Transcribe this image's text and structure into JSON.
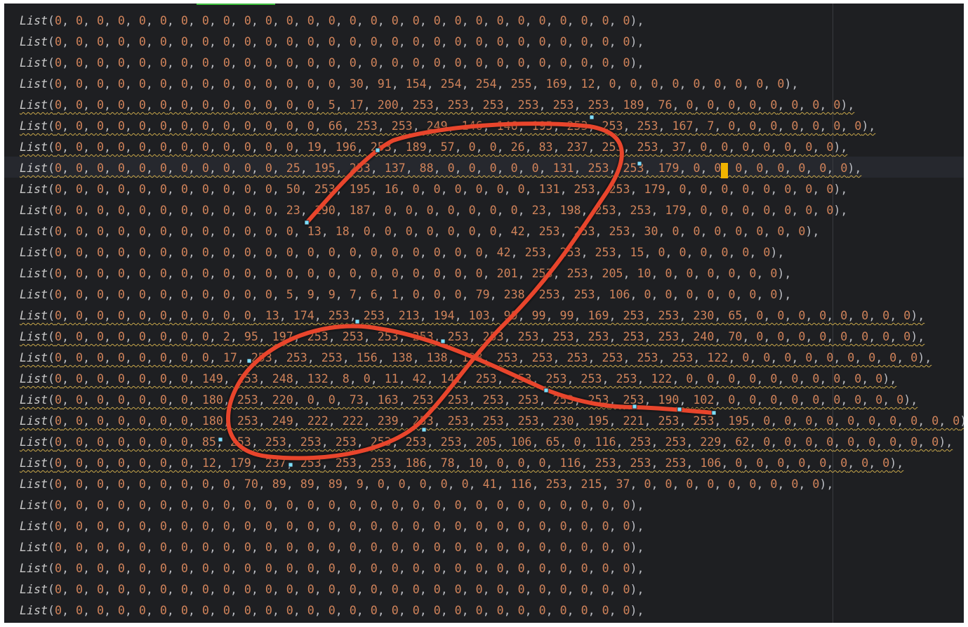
{
  "editor": {
    "keyword": "List",
    "current_line_index": 7,
    "caret_line": 7,
    "caret_col_index": 26,
    "squiggle_lines": [
      4,
      5,
      6,
      7,
      14,
      15,
      16,
      17,
      18,
      19,
      20,
      21
    ],
    "rows": [
      [
        0,
        0,
        0,
        0,
        0,
        0,
        0,
        0,
        0,
        0,
        0,
        0,
        0,
        0,
        0,
        0,
        0,
        0,
        0,
        0,
        0,
        0,
        0,
        0,
        0,
        0,
        0,
        0
      ],
      [
        0,
        0,
        0,
        0,
        0,
        0,
        0,
        0,
        0,
        0,
        0,
        0,
        0,
        0,
        0,
        0,
        0,
        0,
        0,
        0,
        0,
        0,
        0,
        0,
        0,
        0,
        0,
        0
      ],
      [
        0,
        0,
        0,
        0,
        0,
        0,
        0,
        0,
        0,
        0,
        0,
        0,
        0,
        0,
        0,
        0,
        0,
        0,
        0,
        0,
        0,
        0,
        0,
        0,
        0,
        0,
        0,
        0
      ],
      [
        0,
        0,
        0,
        0,
        0,
        0,
        0,
        0,
        0,
        0,
        0,
        0,
        0,
        0,
        30,
        91,
        154,
        254,
        254,
        255,
        169,
        12,
        0,
        0,
        0,
        0,
        0,
        0,
        0,
        0,
        0
      ],
      [
        0,
        0,
        0,
        0,
        0,
        0,
        0,
        0,
        0,
        0,
        0,
        0,
        0,
        5,
        17,
        200,
        253,
        253,
        253,
        253,
        253,
        253,
        189,
        76,
        0,
        0,
        0,
        0,
        0,
        0,
        0,
        0
      ],
      [
        0,
        0,
        0,
        0,
        0,
        0,
        0,
        0,
        0,
        0,
        0,
        0,
        0,
        66,
        253,
        253,
        249,
        146,
        146,
        195,
        253,
        253,
        253,
        167,
        7,
        0,
        0,
        0,
        0,
        0,
        0,
        0
      ],
      [
        0,
        0,
        0,
        0,
        0,
        0,
        0,
        0,
        0,
        0,
        0,
        0,
        19,
        196,
        253,
        189,
        57,
        0,
        0,
        26,
        83,
        237,
        253,
        253,
        37,
        0,
        0,
        0,
        0,
        0,
        0,
        0
      ],
      [
        0,
        0,
        0,
        0,
        0,
        0,
        0,
        0,
        0,
        0,
        0,
        25,
        195,
        253,
        137,
        88,
        0,
        0,
        0,
        0,
        0,
        131,
        253,
        253,
        179,
        0,
        0,
        0,
        0,
        0,
        0,
        0,
        0
      ],
      [
        0,
        0,
        0,
        0,
        0,
        0,
        0,
        0,
        0,
        0,
        0,
        50,
        253,
        195,
        16,
        0,
        0,
        0,
        0,
        0,
        0,
        131,
        253,
        253,
        179,
        0,
        0,
        0,
        0,
        0,
        0,
        0,
        0
      ],
      [
        0,
        0,
        0,
        0,
        0,
        0,
        0,
        0,
        0,
        0,
        0,
        23,
        190,
        187,
        0,
        0,
        0,
        0,
        0,
        0,
        0,
        23,
        198,
        253,
        253,
        179,
        0,
        0,
        0,
        0,
        0,
        0,
        0
      ],
      [
        0,
        0,
        0,
        0,
        0,
        0,
        0,
        0,
        0,
        0,
        0,
        0,
        13,
        18,
        0,
        0,
        0,
        0,
        0,
        0,
        0,
        42,
        253,
        253,
        253,
        30,
        0,
        0,
        0,
        0,
        0,
        0,
        0
      ],
      [
        0,
        0,
        0,
        0,
        0,
        0,
        0,
        0,
        0,
        0,
        0,
        0,
        0,
        0,
        0,
        0,
        0,
        0,
        0,
        0,
        0,
        42,
        253,
        253,
        253,
        15,
        0,
        0,
        0,
        0,
        0,
        0
      ],
      [
        0,
        0,
        0,
        0,
        0,
        0,
        0,
        0,
        0,
        0,
        0,
        0,
        0,
        0,
        0,
        0,
        0,
        0,
        0,
        0,
        0,
        201,
        253,
        253,
        205,
        10,
        0,
        0,
        0,
        0,
        0,
        0
      ],
      [
        0,
        0,
        0,
        0,
        0,
        0,
        0,
        0,
        0,
        0,
        0,
        5,
        9,
        9,
        7,
        6,
        1,
        0,
        0,
        0,
        79,
        238,
        253,
        253,
        106,
        0,
        0,
        0,
        0,
        0,
        0,
        0
      ],
      [
        0,
        0,
        0,
        0,
        0,
        0,
        0,
        0,
        0,
        0,
        13,
        174,
        253,
        253,
        213,
        194,
        103,
        99,
        99,
        99,
        169,
        253,
        253,
        230,
        65,
        0,
        0,
        0,
        0,
        0,
        0,
        0,
        0
      ],
      [
        0,
        0,
        0,
        0,
        0,
        0,
        0,
        0,
        2,
        95,
        197,
        253,
        253,
        253,
        253,
        253,
        253,
        253,
        253,
        253,
        253,
        253,
        240,
        70,
        0,
        0,
        0,
        0,
        0,
        0,
        0,
        0
      ],
      [
        0,
        0,
        0,
        0,
        0,
        0,
        0,
        0,
        17,
        253,
        253,
        253,
        156,
        138,
        138,
        138,
        253,
        253,
        253,
        253,
        253,
        253,
        122,
        0,
        0,
        0,
        0,
        0,
        0,
        0,
        0,
        0
      ],
      [
        0,
        0,
        0,
        0,
        0,
        0,
        0,
        149,
        253,
        248,
        132,
        8,
        0,
        11,
        42,
        141,
        253,
        253,
        253,
        253,
        253,
        122,
        0,
        0,
        0,
        0,
        0,
        0,
        0,
        0,
        0,
        0
      ],
      [
        0,
        0,
        0,
        0,
        0,
        0,
        0,
        180,
        253,
        220,
        0,
        0,
        73,
        163,
        253,
        253,
        253,
        253,
        253,
        253,
        253,
        190,
        102,
        0,
        0,
        0,
        0,
        0,
        0,
        0,
        0,
        0
      ],
      [
        0,
        0,
        0,
        0,
        0,
        0,
        0,
        180,
        253,
        249,
        222,
        222,
        239,
        253,
        253,
        253,
        253,
        230,
        195,
        221,
        253,
        253,
        195,
        0,
        0,
        0,
        0,
        0,
        0,
        0,
        0,
        0,
        0
      ],
      [
        0,
        0,
        0,
        0,
        0,
        0,
        0,
        85,
        253,
        253,
        253,
        253,
        253,
        253,
        253,
        205,
        106,
        65,
        0,
        116,
        253,
        253,
        229,
        62,
        0,
        0,
        0,
        0,
        0,
        0,
        0,
        0,
        0
      ],
      [
        0,
        0,
        0,
        0,
        0,
        0,
        0,
        12,
        179,
        237,
        253,
        253,
        253,
        186,
        78,
        10,
        0,
        0,
        0,
        116,
        253,
        253,
        253,
        106,
        0,
        0,
        0,
        0,
        0,
        0,
        0,
        0
      ],
      [
        0,
        0,
        0,
        0,
        0,
        0,
        0,
        0,
        0,
        70,
        89,
        89,
        89,
        9,
        0,
        0,
        0,
        0,
        0,
        41,
        116,
        253,
        215,
        37,
        0,
        0,
        0,
        0,
        0,
        0,
        0,
        0,
        0
      ],
      [
        0,
        0,
        0,
        0,
        0,
        0,
        0,
        0,
        0,
        0,
        0,
        0,
        0,
        0,
        0,
        0,
        0,
        0,
        0,
        0,
        0,
        0,
        0,
        0,
        0,
        0,
        0,
        0
      ],
      [
        0,
        0,
        0,
        0,
        0,
        0,
        0,
        0,
        0,
        0,
        0,
        0,
        0,
        0,
        0,
        0,
        0,
        0,
        0,
        0,
        0,
        0,
        0,
        0,
        0,
        0,
        0,
        0
      ],
      [
        0,
        0,
        0,
        0,
        0,
        0,
        0,
        0,
        0,
        0,
        0,
        0,
        0,
        0,
        0,
        0,
        0,
        0,
        0,
        0,
        0,
        0,
        0,
        0,
        0,
        0,
        0,
        0
      ],
      [
        0,
        0,
        0,
        0,
        0,
        0,
        0,
        0,
        0,
        0,
        0,
        0,
        0,
        0,
        0,
        0,
        0,
        0,
        0,
        0,
        0,
        0,
        0,
        0,
        0,
        0,
        0,
        0
      ],
      [
        0,
        0,
        0,
        0,
        0,
        0,
        0,
        0,
        0,
        0,
        0,
        0,
        0,
        0,
        0,
        0,
        0,
        0,
        0,
        0,
        0,
        0,
        0,
        0,
        0,
        0,
        0,
        0
      ],
      [
        0,
        0,
        0,
        0,
        0,
        0,
        0,
        0,
        0,
        0,
        0,
        0,
        0,
        0,
        0,
        0,
        0,
        0,
        0,
        0,
        0,
        0,
        0,
        0,
        0,
        0,
        0,
        0
      ]
    ]
  },
  "colors": {
    "editor_bg": "#1e1f22",
    "current_line_bg": "#26282e",
    "number": "#d0835a",
    "keyword": "#c8c8c8",
    "punctuation": "#bcbec4",
    "stroke": "#e8452c",
    "control_point": "#7fe0ff",
    "caret": "#f0b400",
    "progress": "#3dbf3d"
  }
}
